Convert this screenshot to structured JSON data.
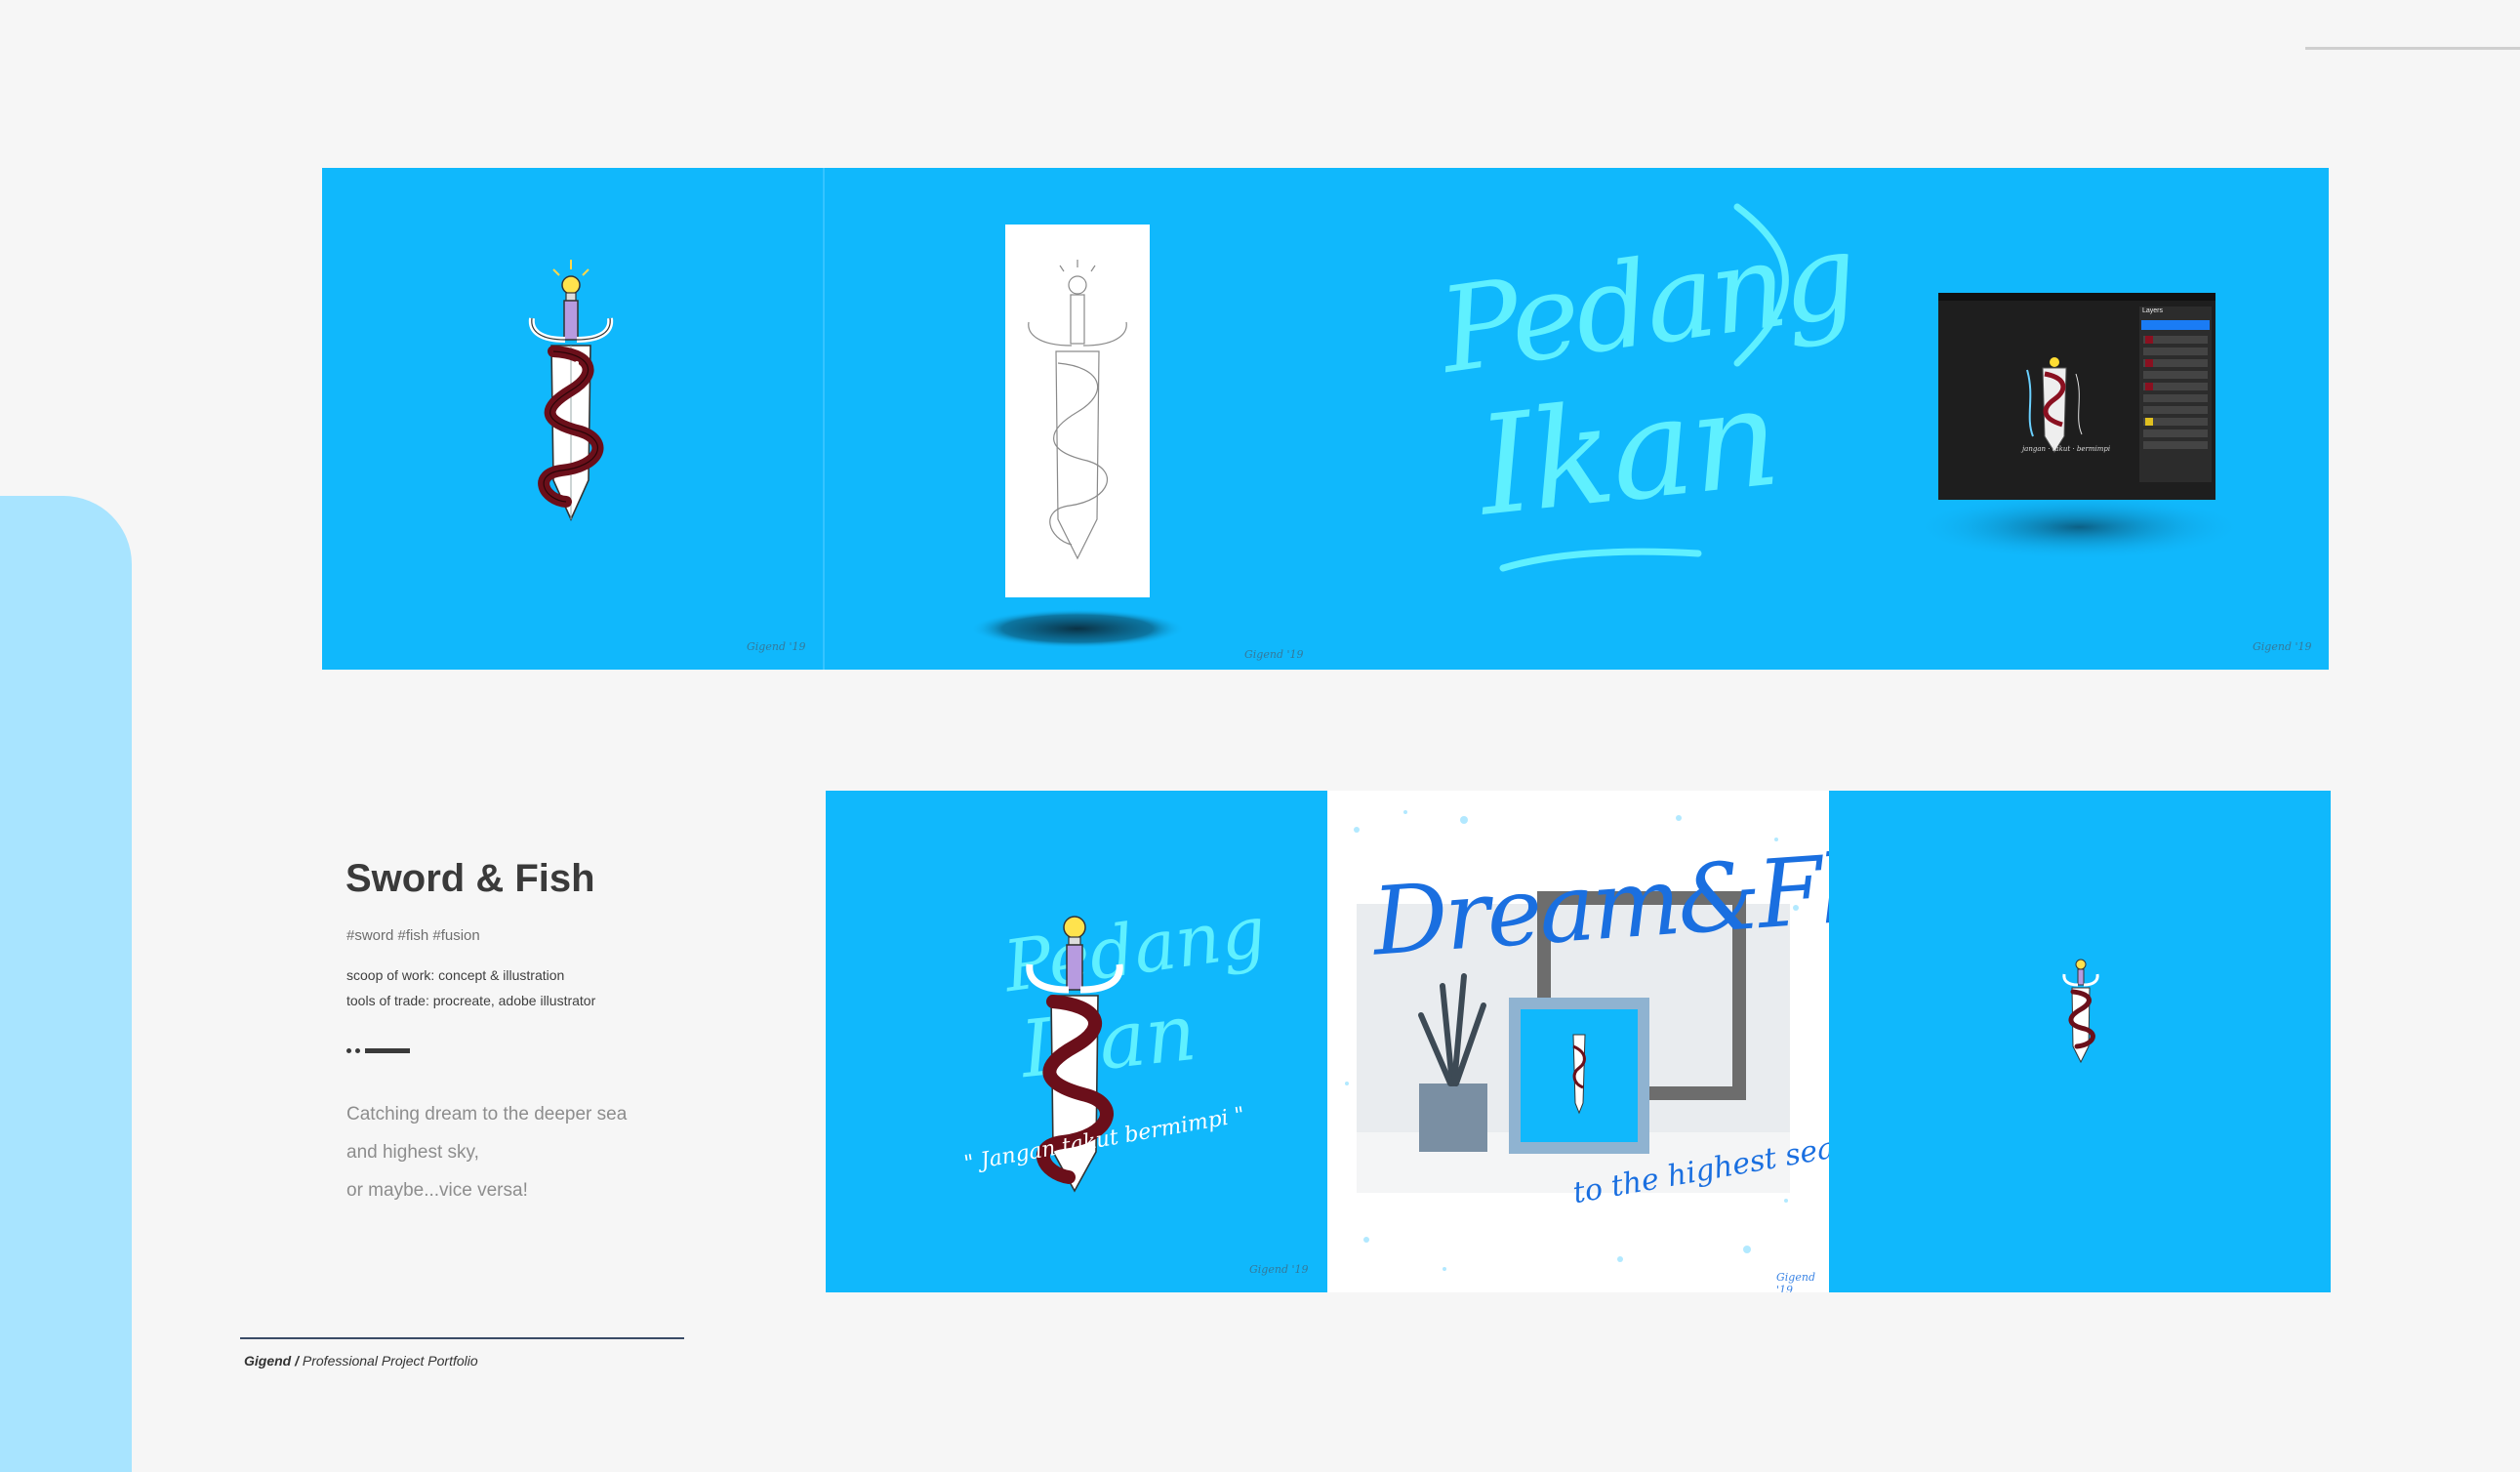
{
  "project": {
    "title": "Sword & Fish",
    "tags": "#sword #fish #fusion",
    "scope": "scoop of work: concept & illustration",
    "tools": "tools of trade: procreate, adobe illustrator",
    "description": [
      "Catching dream to the deeper sea",
      "and highest sky,",
      "or maybe...vice versa!"
    ]
  },
  "footer": {
    "brand": "Gigend /",
    "subtitle": "Professional Project Portfolio"
  },
  "artwork": {
    "lettering_word1": "Pedang",
    "lettering_word2": "Ikan",
    "tagline": "\" Jangan  takut  bermimpi \"",
    "dream_headline": "Dream&Fly",
    "dream_caption": "to the highest sea",
    "signature": "Gigend '19",
    "procreate_panel_title": "Layers"
  },
  "colors": {
    "panel_blue": "#10b8fc",
    "side_tab": "#a8e4ff",
    "title": "#3a3a3a",
    "muted_text": "#8d8d8d"
  }
}
